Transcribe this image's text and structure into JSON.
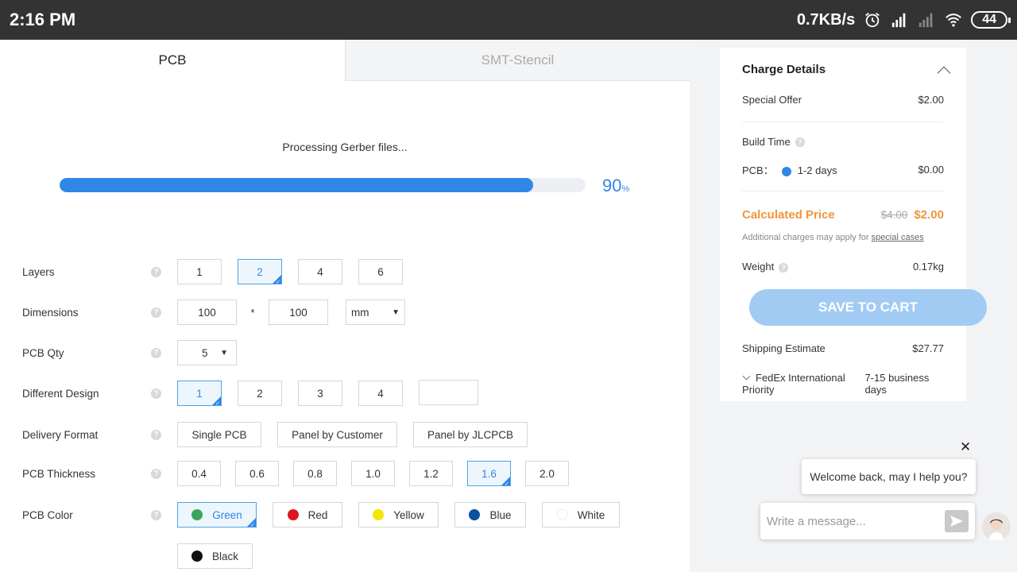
{
  "status_bar": {
    "time": "2:16 PM",
    "speed": "0.7KB/s",
    "battery": "44"
  },
  "tabs": [
    {
      "label": "PCB"
    },
    {
      "label": "SMT-Stencil"
    }
  ],
  "processing": {
    "text": "Processing Gerber files...",
    "percent": 90,
    "percent_label": "90",
    "percent_unit": "%"
  },
  "form": {
    "layers": {
      "label": "Layers",
      "options": [
        "1",
        "2",
        "4",
        "6"
      ],
      "selected": "2"
    },
    "dimensions": {
      "label": "Dimensions",
      "width": "100",
      "separator": "*",
      "height": "100",
      "unit": "mm"
    },
    "qty": {
      "label": "PCB Qty",
      "value": "5"
    },
    "different_design": {
      "label": "Different Design",
      "options": [
        "1",
        "2",
        "3",
        "4"
      ],
      "selected": "1",
      "custom": ""
    },
    "delivery_format": {
      "label": "Delivery Format",
      "options": [
        "Single PCB",
        "Panel by Customer",
        "Panel by JLCPCB"
      ]
    },
    "thickness": {
      "label": "PCB Thickness",
      "options": [
        "0.4",
        "0.6",
        "0.8",
        "1.0",
        "1.2",
        "1.6",
        "2.0"
      ],
      "selected": "1.6"
    },
    "color": {
      "label": "PCB Color",
      "options": [
        {
          "name": "Green",
          "color": "#3aa65b"
        },
        {
          "name": "Red",
          "color": "#e0141e"
        },
        {
          "name": "Yellow",
          "color": "#f6e600"
        },
        {
          "name": "Blue",
          "color": "#0b4fa0"
        },
        {
          "name": "White",
          "color": "#ffffff"
        },
        {
          "name": "Black",
          "color": "#111111"
        }
      ],
      "selected": "Green"
    }
  },
  "charges": {
    "title": "Charge Details",
    "special_offer": {
      "label": "Special Offer",
      "value": "$2.00"
    },
    "build_time": {
      "label": "Build Time",
      "pcb_label": "PCB：",
      "pcb_option": "1-2 days",
      "pcb_price": "$0.00"
    },
    "calculated": {
      "label": "Calculated Price",
      "old": "$4.00",
      "new": "$2.00"
    },
    "note": {
      "text": "Additional charges may apply for ",
      "link": "special cases"
    },
    "weight": {
      "label": "Weight",
      "value": "0.17kg"
    },
    "save_button": "SAVE TO CART",
    "shipping": {
      "label": "Shipping Estimate",
      "value": "$27.77",
      "carrier": "FedEx International Priority",
      "time": "7-15 business days"
    }
  },
  "chat": {
    "close": "✕",
    "welcome": "Welcome back, may I help you?",
    "placeholder": "Write a message..."
  }
}
